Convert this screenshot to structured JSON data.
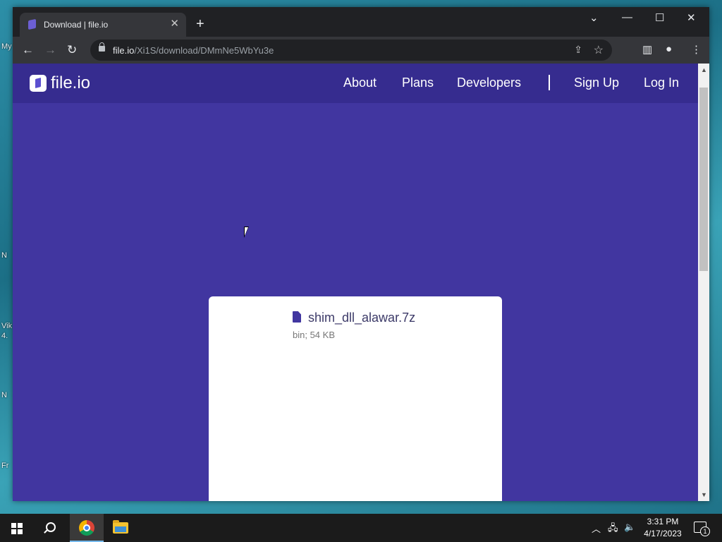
{
  "desktop": {
    "edge_labels": [
      "My",
      "N",
      "Vik",
      "4.",
      "N",
      "Fr"
    ]
  },
  "browser": {
    "tab": {
      "title": "Download | file.io",
      "close": "✕"
    },
    "new_tab": "+",
    "window_controls": {
      "dropdown": "⌄",
      "minimize": "—",
      "maximize": "☐",
      "close": "✕"
    },
    "nav": {
      "back": "←",
      "forward": "→",
      "reload": "↻"
    },
    "url": {
      "host": "file.io",
      "path": "/Xi1S/download/DMmNe5WbYu3e"
    }
  },
  "site": {
    "logo_text": "file.io",
    "nav_links": [
      "About",
      "Plans",
      "Developers",
      "Sign Up",
      "Log In"
    ],
    "file": {
      "name": "shim_dll_alawar.7z",
      "meta": "bin; 54 KB"
    }
  },
  "taskbar": {
    "clock_time": "3:31 PM",
    "clock_date": "4/17/2023",
    "notification_count": "1"
  }
}
